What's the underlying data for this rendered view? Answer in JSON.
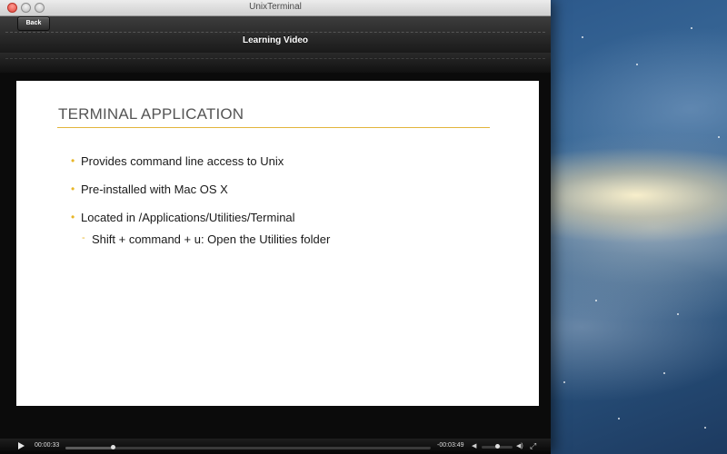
{
  "window": {
    "title": "UnixTerminal"
  },
  "navbar": {
    "back_label": "Back",
    "title": "Learning Video"
  },
  "slide": {
    "title": "TERMINAL APPLICATION",
    "bullets": [
      "Provides command line access to Unix",
      "Pre-installed with Mac OS X",
      "Located in /Applications/Utilities/Terminal"
    ],
    "sub_bullets": [
      "Shift + command + u: Open the Utilities folder"
    ],
    "bullet_marker": "•",
    "sub_bullet_marker": "-",
    "accent_color": "#e8b628"
  },
  "player": {
    "elapsed": "00:00:33",
    "remaining": "-00:03:49",
    "progress_fraction": 0.13,
    "volume_fraction": 0.5,
    "icons": {
      "play": "play-icon",
      "volume_low": "volume-low-icon",
      "volume_high": "volume-high-icon",
      "fullscreen": "fullscreen-icon"
    }
  }
}
